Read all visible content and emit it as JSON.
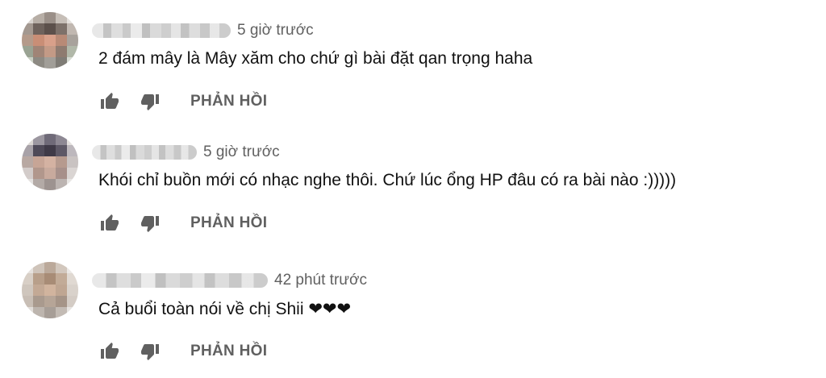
{
  "comments": [
    {
      "timestamp": "5 giờ trước",
      "text": "2 đám mây là Mây xăm cho chứ gì bài đặt qan trọng haha",
      "reply_label": "PHẢN HỒI",
      "like_icon": "thumbs-up-icon",
      "dislike_icon": "thumbs-down-icon"
    },
    {
      "timestamp": "5 giờ trước",
      "text": "Khói chỉ buồn mới có nhạc nghe thôi. Chứ lúc ổng HP đâu có ra bài nào :)))))",
      "reply_label": "PHẢN HỒI",
      "like_icon": "thumbs-up-icon",
      "dislike_icon": "thumbs-down-icon"
    },
    {
      "timestamp": "42 phút trước",
      "text": "Cả buổi toàn nói về chị Shii ❤❤❤",
      "reply_label": "PHẢN HỒI",
      "like_icon": "thumbs-up-icon",
      "dislike_icon": "thumbs-down-icon"
    }
  ],
  "colors": {
    "text": "#111111",
    "secondary": "#606060",
    "background": "#ffffff"
  }
}
